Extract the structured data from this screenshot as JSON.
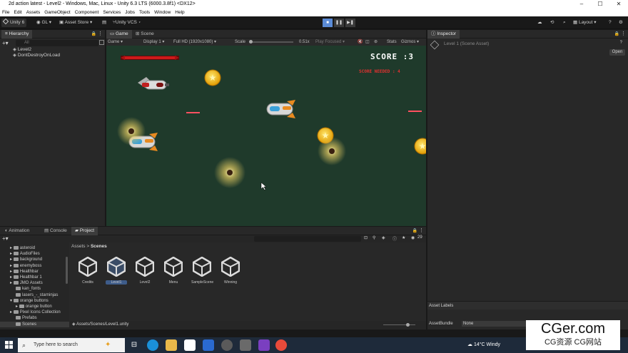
{
  "window": {
    "title": "2d action latest - Level2 - Windows, Mac, Linux - Unity 6.3 LTS (6000.3.8f1) <DX12>",
    "minimize": "–",
    "maximize": "☐",
    "close": "✕"
  },
  "menu": [
    "File",
    "Edit",
    "Assets",
    "GameObject",
    "Component",
    "Services",
    "Jobs",
    "Tools",
    "Window",
    "Help"
  ],
  "toolbar": {
    "account": "Unity 6",
    "gl": "GL",
    "asset_store": "Asset Store",
    "vcs": "Unity VCS",
    "layout": "Layout",
    "play_symbol": "■",
    "pause_symbol": "❚❚",
    "step_symbol": "▶❚"
  },
  "hierarchy": {
    "tab": "Hierarchy",
    "search_placeholder": "All",
    "items": [
      "Level2",
      "DontDestroyOnLoad"
    ]
  },
  "game_view": {
    "tabs": [
      "Game",
      "Scene"
    ],
    "display_mode": "Game",
    "display": "Display 1",
    "resolution": "Full HD (1920x1080)",
    "scale_label": "Scale",
    "scale_value": "0.51x",
    "play_focused": "Play Focused",
    "stats": "Stats",
    "gizmos": "Gizmos",
    "score_text": "SCORE :3",
    "score_needed_text": "SCORE NEEDED : 4",
    "background_color": "#1f3a2b",
    "health_color": "#cc1a1a"
  },
  "inspector": {
    "tab": "Inspector",
    "title": "Level 1 (Scene Asset)",
    "open_button": "Open",
    "asset_labels": "Asset Labels",
    "asset_bundle_label": "AssetBundle",
    "asset_bundle_value": "None"
  },
  "bottom_tabs": [
    "Animation",
    "Console",
    "Project"
  ],
  "project": {
    "breadcrumb_root": "Assets",
    "breadcrumb_sep": ">",
    "breadcrumb_current": "Scenes",
    "hidden_count": "29",
    "tree": [
      "asteroid",
      "AudioFiles",
      "background",
      "enemyboss",
      "Healthbar",
      "Healthbar 1",
      "JMO Assets",
      "kan_fonts",
      "lasers_-_starninjas",
      "orange buttons",
      "orange button",
      "Pixel Icons Collection",
      "Prefabs",
      "Scenes"
    ],
    "assets": [
      "Credits",
      "Level1",
      "Level2",
      "Menu",
      "SampleScene",
      "Winning"
    ],
    "status_path": "Assets/Scenes/Level1.unity"
  },
  "taskbar": {
    "search_placeholder": "Type here to search",
    "weather": "14°C  Windy"
  },
  "watermark": {
    "main": "CGer.com",
    "sub": "CG资源 CG网站"
  }
}
